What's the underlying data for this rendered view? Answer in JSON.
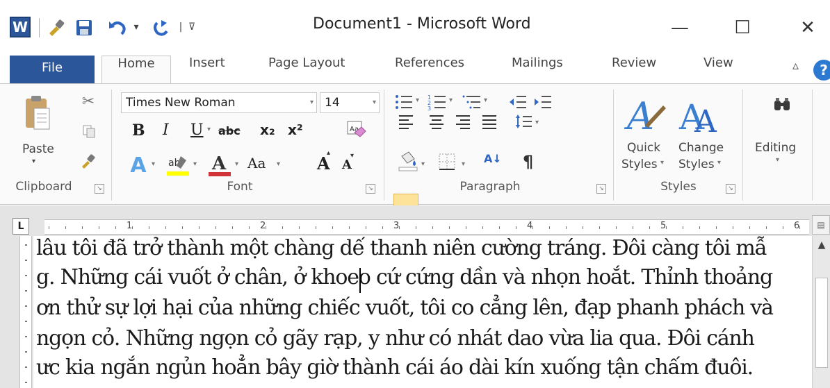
{
  "window": {
    "title": "Document1 - Microsoft Word",
    "app_icon_letter": "W",
    "controls": {
      "minimize": "—",
      "maximize": "☐",
      "close": "✕"
    }
  },
  "quick_access": {
    "separator_char": "|",
    "customize_char": "⊽"
  },
  "tabs": {
    "file": "File",
    "home": "Home",
    "insert": "Insert",
    "page_layout": "Page Layout",
    "references": "References",
    "mailings": "Mailings",
    "review": "Review",
    "view": "View",
    "collapse_char": "▵",
    "help_char": "?"
  },
  "clipboard": {
    "paste_label": "Paste",
    "group_label": "Clipboard"
  },
  "font": {
    "font_name": "Times New Roman",
    "font_size": "14",
    "bold": "B",
    "italic": "I",
    "underline": "U",
    "strike": "abc",
    "subscript": "x₂",
    "superscript": "x²",
    "grow": "A",
    "shrink": "A",
    "change_case": "Aa",
    "group_label": "Font"
  },
  "paragraph": {
    "sort_label": "A↓",
    "pilcrow": "¶",
    "group_label": "Paragraph"
  },
  "styles": {
    "quick_styles_line1": "Quick",
    "quick_styles_line2": "Styles",
    "change_styles_line1": "Change",
    "change_styles_line2": "Styles",
    "group_label": "Styles"
  },
  "editing": {
    "label": "Editing"
  },
  "ruler": {
    "corner": "L",
    "numbers": [
      "1",
      "2",
      "3",
      "4",
      "5",
      "6"
    ]
  },
  "document": {
    "lines": [
      "lâu tôi đã trở thành một chàng dế thanh niên cường tráng. Đôi càng tôi mẫ",
      "g. Những cái vuốt ở chân, ở khoeo cứ cứng dần và nhọn hoắt. Thỉnh thoảng",
      "ơn thử sự lợi hại của những chiếc vuốt, tôi co cẳng lên, đạp phanh phách và",
      "ngọn cỏ. Những ngọn cỏ gãy rạp, y như có nhát dao vừa lia qua. Đôi cánh",
      "ưc kia ngắn ngủn hoẳn bây giờ thành cái áo dài kín xuống tận chấm đuôi."
    ]
  },
  "colors": {
    "file_tab": "#2b579a",
    "highlight_button": "#fde399",
    "font_color_bar": "#d13438",
    "highlight_bar": "#ffff00"
  }
}
